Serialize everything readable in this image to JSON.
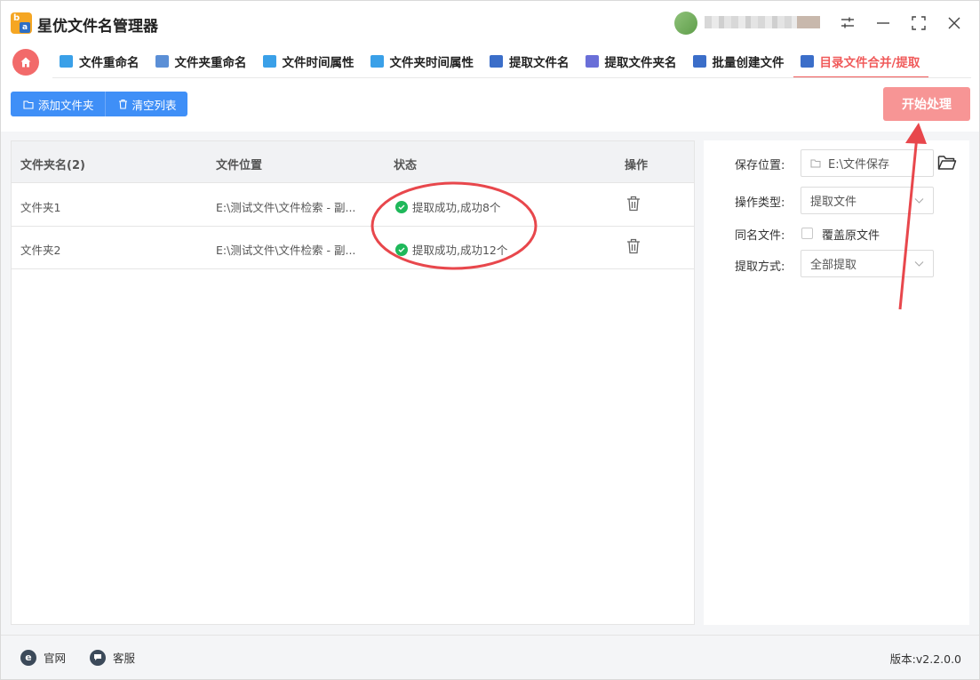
{
  "app": {
    "title": "星优文件名管理器",
    "logo_letters": [
      "b",
      "a"
    ]
  },
  "tabs": [
    {
      "label": "文件重命名",
      "icon": "file-rename-icon",
      "color": "#3aa0e8",
      "active": false
    },
    {
      "label": "文件夹重命名",
      "icon": "folder-rename-icon",
      "color": "#5b8fd6",
      "active": false
    },
    {
      "label": "文件时间属性",
      "icon": "file-time-icon",
      "color": "#3aa0e8",
      "active": false
    },
    {
      "label": "文件夹时间属性",
      "icon": "folder-time-icon",
      "color": "#3aa0e8",
      "active": false
    },
    {
      "label": "提取文件名",
      "icon": "extract-filename-icon",
      "color": "#3b6ec9",
      "active": false
    },
    {
      "label": "提取文件夹名",
      "icon": "extract-foldername-icon",
      "color": "#6a6fd8",
      "active": false
    },
    {
      "label": "批量创建文件",
      "icon": "batch-create-icon",
      "color": "#3b6ec9",
      "active": false
    },
    {
      "label": "目录文件合并/提取",
      "icon": "merge-extract-icon",
      "color": "#3b6ec9",
      "active": true
    }
  ],
  "toolbar": {
    "add_folder": "添加文件夹",
    "clear_list": "清空列表",
    "start": "开始处理"
  },
  "table": {
    "headers": {
      "name": "文件夹名(2)",
      "location": "文件位置",
      "status": "状态",
      "action": "操作"
    },
    "rows": [
      {
        "name": "文件夹1",
        "location": "E:\\测试文件\\文件检索 - 副...",
        "status": "提取成功,成功8个"
      },
      {
        "name": "文件夹2",
        "location": "E:\\测试文件\\文件检索 - 副...",
        "status": "提取成功,成功12个"
      }
    ]
  },
  "settings": {
    "save_location_label": "保存位置:",
    "save_location_value": "E:\\文件保存",
    "op_type_label": "操作类型:",
    "op_type_value": "提取文件",
    "same_name_label": "同名文件:",
    "overwrite_label": "覆盖原文件",
    "overwrite_checked": false,
    "extract_mode_label": "提取方式:",
    "extract_mode_value": "全部提取"
  },
  "footer": {
    "website": "官网",
    "support": "客服",
    "version": "版本:v2.2.0.0"
  },
  "colors": {
    "accent_red": "#f05a5a",
    "primary_blue": "#3f8ff7",
    "start_button": "#f79595",
    "success_green": "#1fb85a",
    "annotation_red": "#e8474c"
  }
}
